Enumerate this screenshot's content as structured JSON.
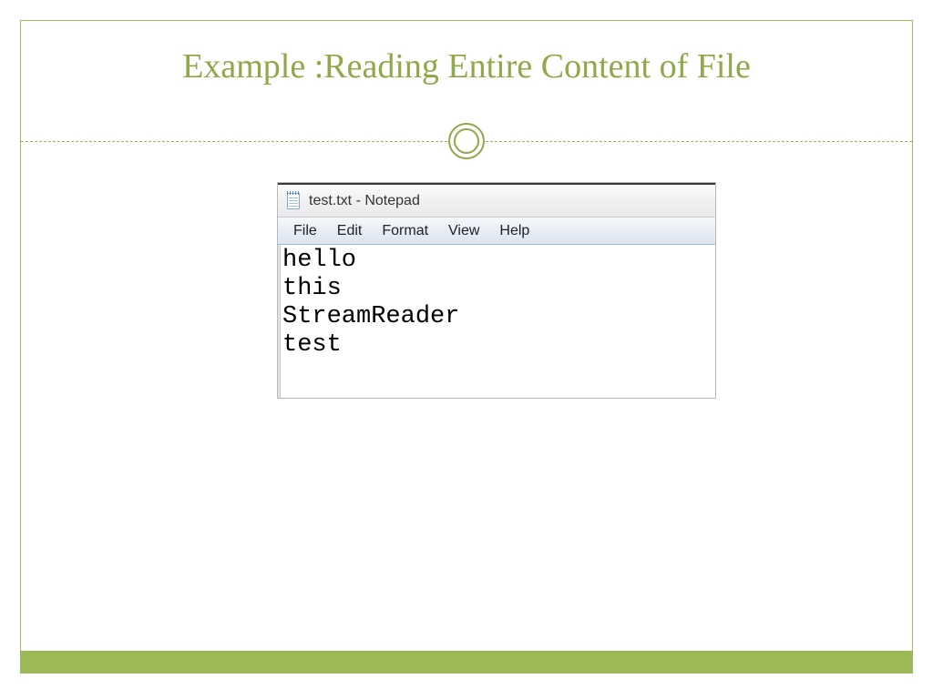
{
  "slide": {
    "title": "Example :Reading Entire Content of File"
  },
  "notepad": {
    "title": "test.txt - Notepad",
    "menu": {
      "file": "File",
      "edit": "Edit",
      "format": "Format",
      "view": "View",
      "help": "Help"
    },
    "content": "hello\nthis\nStreamReader\ntest"
  }
}
